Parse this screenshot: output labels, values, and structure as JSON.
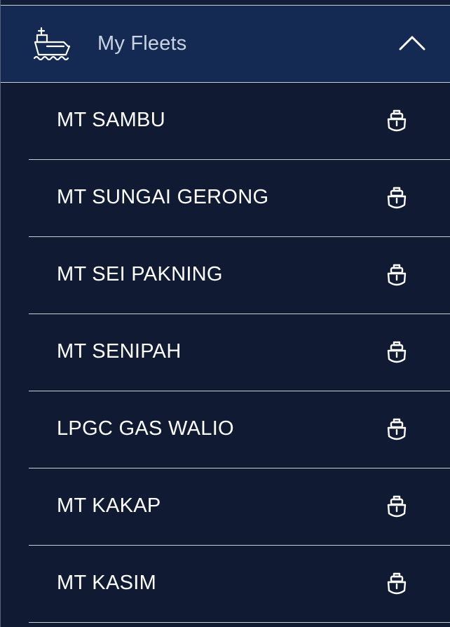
{
  "header": {
    "title": "My Fleets",
    "icon": "ship-icon",
    "toggle_icon": "chevron-up-icon"
  },
  "fleet": {
    "items": [
      {
        "label": "MT SAMBU",
        "icon": "ship-bow-icon"
      },
      {
        "label": "MT SUNGAI GERONG",
        "icon": "ship-bow-icon"
      },
      {
        "label": "MT SEI PAKNING",
        "icon": "ship-bow-icon"
      },
      {
        "label": "MT SENIPAH",
        "icon": "ship-bow-icon"
      },
      {
        "label": "LPGC GAS WALIO",
        "icon": "ship-bow-icon"
      },
      {
        "label": "MT KAKAP",
        "icon": "ship-bow-icon"
      },
      {
        "label": "MT KASIM",
        "icon": "ship-bow-icon"
      }
    ]
  },
  "colors": {
    "background": "#101b33",
    "header_background": "#142a52",
    "divider": "#c9ced8",
    "text": "#ffffff"
  }
}
